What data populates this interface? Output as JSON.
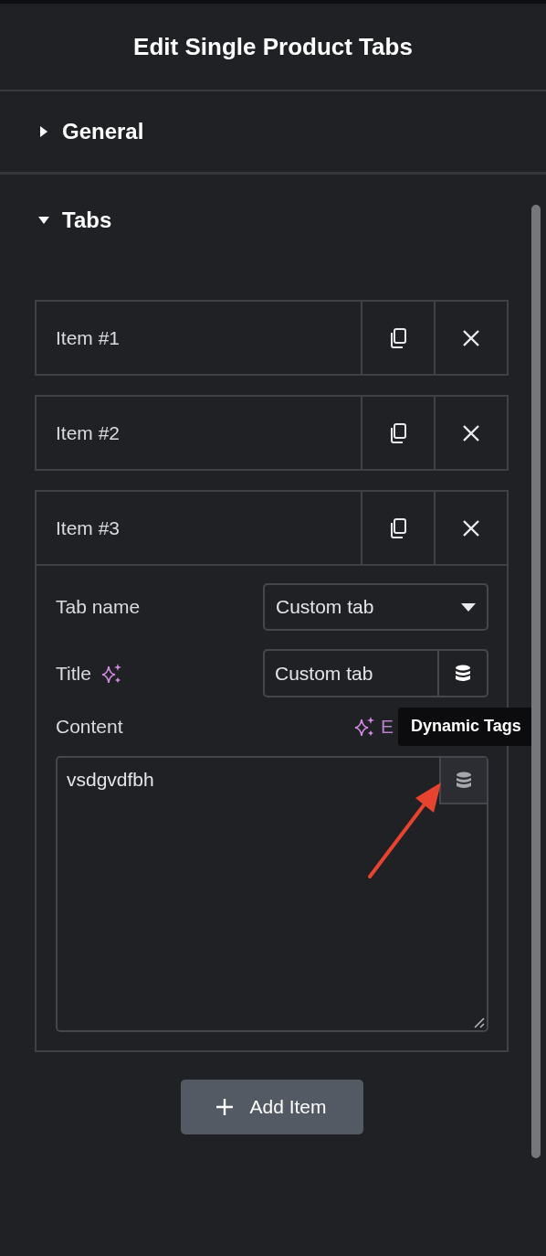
{
  "header": {
    "title": "Edit Single Product Tabs"
  },
  "sections": [
    {
      "label": "General",
      "expanded": false
    },
    {
      "label": "Tabs",
      "expanded": true
    }
  ],
  "items": [
    {
      "label": "Item #1",
      "expanded": false
    },
    {
      "label": "Item #2",
      "expanded": false
    },
    {
      "label": "Item #3",
      "expanded": true,
      "fields": {
        "tab_name": {
          "label": "Tab name",
          "value": "Custom tab"
        },
        "title": {
          "label": "Title",
          "value": "Custom tab"
        },
        "content": {
          "label": "Content",
          "ai_link": "E",
          "value": "vsdgvdfbh"
        }
      }
    }
  ],
  "tooltip": "Dynamic Tags",
  "add_button": "Add Item"
}
